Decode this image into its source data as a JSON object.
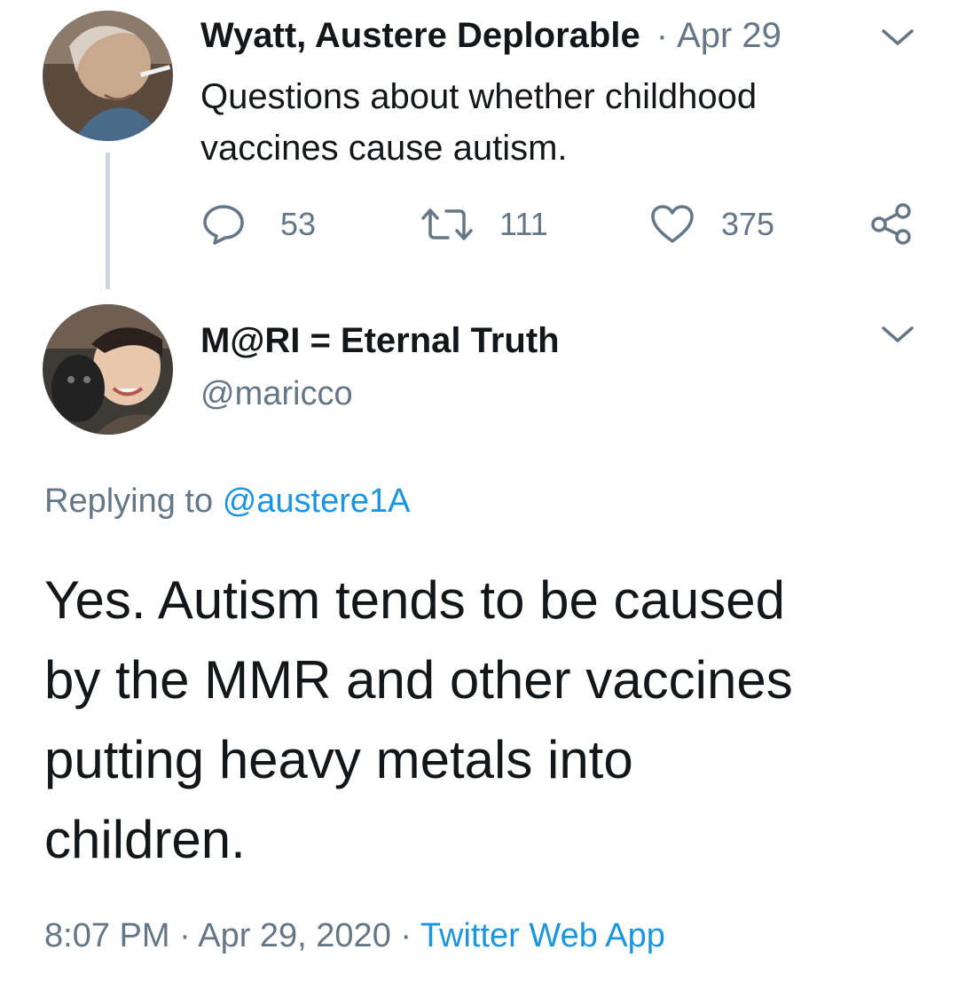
{
  "parent_tweet": {
    "author_name": "Wyatt, Austere Deplorable",
    "separator": "·",
    "date": "Apr 29",
    "text_line1": "Questions about whether childhood",
    "text_line2": "vaccines cause autism.",
    "replies": "53",
    "retweets": "111",
    "likes": "375"
  },
  "reply_tweet": {
    "author_name": "M@RI = Eternal Truth",
    "handle": "@maricco",
    "replying_prefix": "Replying to",
    "replying_handle": "@austere1A",
    "text_line1": "Yes. Autism tends to be caused",
    "text_line2": "by the MMR and other vaccines",
    "text_line3": "putting heavy metals into",
    "text_line4": "children.",
    "time": "8:07 PM",
    "sep1": "·",
    "date": "Apr 29, 2020",
    "sep2": "·",
    "source": "Twitter Web App"
  },
  "icons": {
    "reply": "reply-icon",
    "retweet": "retweet-icon",
    "like": "heart-icon",
    "share": "share-icon",
    "menu": "chevron-down-icon"
  },
  "colors": {
    "text": "#14171a",
    "muted": "#657786",
    "link": "#1b95e0",
    "thread_line": "#ccd6dd"
  }
}
